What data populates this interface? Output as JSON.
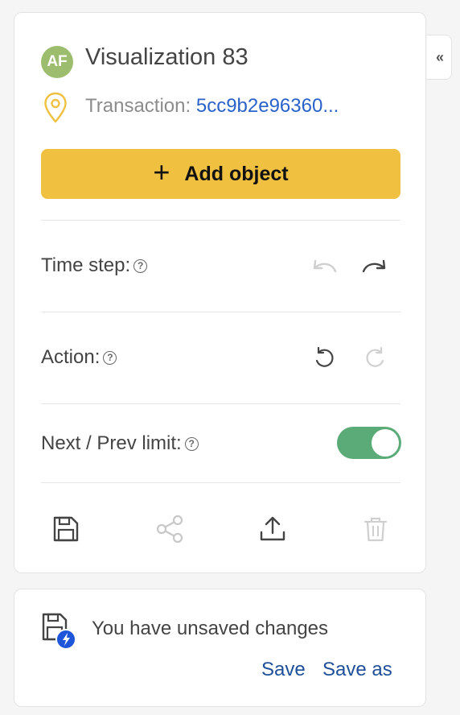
{
  "header": {
    "avatar_initials": "AF",
    "title": "Visualization 83",
    "transaction_label": "Transaction:",
    "transaction_value": "5cc9b2e96360..."
  },
  "actions": {
    "add_object_label": "Add object"
  },
  "rows": {
    "time_step_label": "Time step:",
    "action_label": "Action:",
    "limit_label": "Next / Prev limit:",
    "limit_enabled": true
  },
  "toolbar": {
    "icons": [
      "save-icon",
      "share-icon",
      "upload-icon",
      "trash-icon"
    ]
  },
  "unsaved": {
    "message": "You have unsaved changes",
    "save_label": "Save",
    "save_as_label": "Save as"
  },
  "colors": {
    "accent": "#f0c040",
    "toggle_on": "#5aab77",
    "avatar": "#9dbd6e",
    "link": "#2b62c9",
    "save_link": "#1f4f9a"
  }
}
